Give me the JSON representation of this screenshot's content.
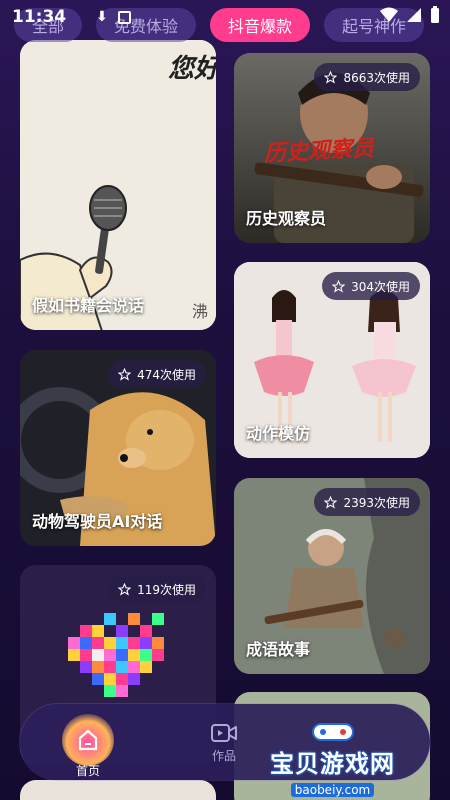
{
  "status": {
    "time": "11:34"
  },
  "tabs": [
    {
      "label": "全部"
    },
    {
      "label": "免费体验"
    },
    {
      "label": "抖音爆款",
      "active": true
    },
    {
      "label": "起号神作"
    }
  ],
  "cards": [
    {
      "title": "假如书籍会说话",
      "image": "book-talk-cartoon",
      "image_text": "您好",
      "signature": "沸"
    },
    {
      "title": "历史观察员",
      "uses": "8663次使用",
      "image": "soldier-rifle",
      "overlay_text": "历史观察员"
    },
    {
      "title": "动物驾驶员AI对话",
      "uses": "474次使用",
      "image": "dog-driving"
    },
    {
      "title": "动作模仿",
      "uses": "304次使用",
      "image": "two-girls-dancing"
    },
    {
      "title": "",
      "uses": "119次使用",
      "image": "pixel-mosaic"
    },
    {
      "title": "成语故事",
      "uses": "2393次使用",
      "image": "old-man-mountain"
    }
  ],
  "nav": {
    "home_label": "首页",
    "works_label": "作品"
  },
  "watermark": {
    "text": "宝贝游戏网",
    "url": "baobeiy.com"
  },
  "colors": {
    "accent": "#ff3c8e",
    "background": "#1c0f3d",
    "tab_bg": "#5a46a0"
  }
}
